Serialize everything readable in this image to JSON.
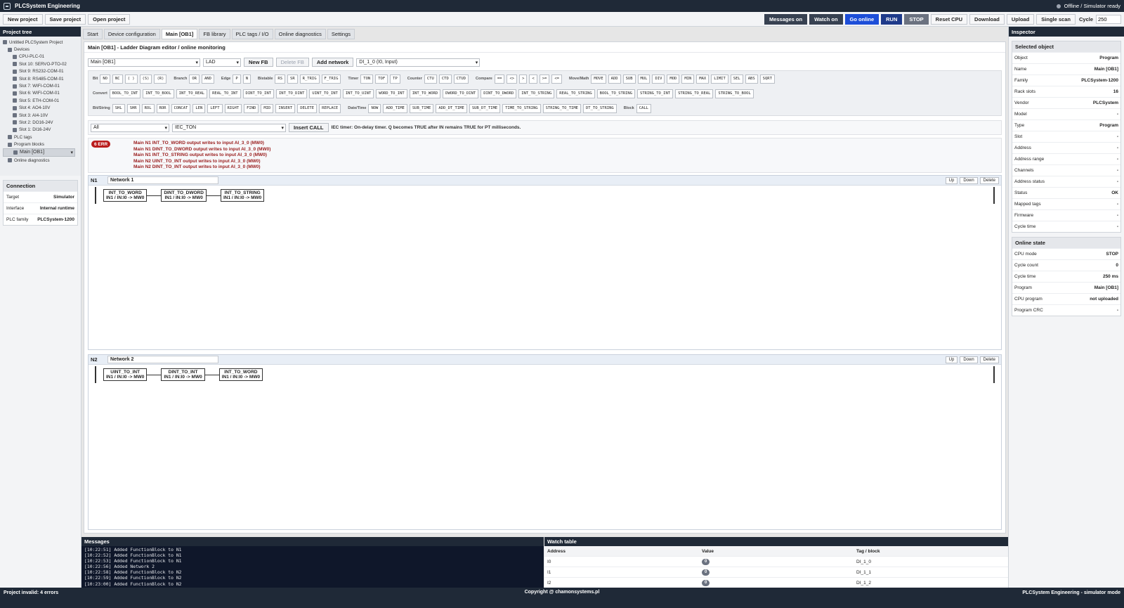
{
  "app": {
    "title": "PLCSystem Engineering",
    "status": "Offline / Simulator ready"
  },
  "toolbar": {
    "new_project": "New project",
    "save_project": "Save project",
    "open_project": "Open project",
    "messages_on": "Messages on",
    "watch_on": "Watch on",
    "go_online": "Go online",
    "run": "RUN",
    "stop": "STOP",
    "reset_cpu": "Reset CPU",
    "download": "Download",
    "upload": "Upload",
    "single_scan": "Single scan",
    "cycle_label": "Cycle",
    "cycle_value": "250"
  },
  "project_tree": {
    "title": "Project tree",
    "items": [
      "Untitled PLCSystem Project",
      "Devices",
      "CPU-PLC-01",
      "Slot 10: SERVO-PTO-02",
      "Slot 9: RS232-COM-01",
      "Slot 8: RS485-COM-01",
      "Slot 7: WIFI-COM-01",
      "Slot 6: WIFI-COM-01",
      "Slot 5: ETH-COM-01",
      "Slot 4: AO4-10V",
      "Slot 3: AI4-10V",
      "Slot 2: DO16-24V",
      "Slot 1: DI16-24V",
      "PLC tags",
      "Program blocks",
      "Main [OB1]",
      "Online diagnostics"
    ]
  },
  "connection": {
    "title": "Connection",
    "rows": [
      {
        "k": "Target",
        "v": "Simulator"
      },
      {
        "k": "Interface",
        "v": "Internal runtime"
      },
      {
        "k": "PLC family",
        "v": "PLCSystem-1200"
      }
    ]
  },
  "tabs": [
    "Start",
    "Device configuration",
    "Main [OB1]",
    "FB library",
    "PLC tags / I/O",
    "Online diagnostics",
    "Settings"
  ],
  "editor": {
    "title": "Main [OB1] - Ladder Diagram editor / online monitoring",
    "block_select": "Main [OB1]",
    "lang_select": "LAD",
    "new_fb": "New FB",
    "delete_fb": "Delete FB",
    "add_network": "Add network",
    "io_select": "DI_1_0 (I0, Input)"
  },
  "palette": {
    "row1": [
      {
        "g": "Bit",
        "b": [
          "NO",
          "NC",
          "( )",
          "(S)",
          "(R)"
        ]
      },
      {
        "g": "Branch",
        "b": [
          "OR",
          "AND"
        ]
      },
      {
        "g": "Edge",
        "b": [
          "P",
          "N"
        ]
      },
      {
        "g": "Bistable",
        "b": [
          "RS",
          "SR",
          "R_TRIG",
          "F_TRIG"
        ]
      },
      {
        "g": "Timer",
        "b": [
          "TON",
          "TOF",
          "TP"
        ]
      },
      {
        "g": "Counter",
        "b": [
          "CTU",
          "CTD",
          "CTUD"
        ]
      },
      {
        "g": "Compare",
        "b": [
          "==",
          "<>",
          ">",
          "<",
          ">=",
          "<="
        ]
      },
      {
        "g": "Move/Math",
        "b": [
          "MOVE",
          "ADD",
          "SUB",
          "MUL",
          "DIV",
          "MOD",
          "MIN",
          "MAX",
          "LIMIT",
          "SEL",
          "ABS",
          "SQRT"
        ]
      }
    ],
    "row2": [
      {
        "g": "Convert",
        "b": [
          "BOOL_TO_INT",
          "INT_TO_BOOL",
          "INT_TO_REAL",
          "REAL_TO_INT",
          "DINT_TO_INT",
          "INT_TO_DINT",
          "UINT_TO_INT",
          "INT_TO_UINT",
          "WORD_TO_INT",
          "INT_TO_WORD",
          "DWORD_TO_DINT",
          "DINT_TO_DWORD",
          "INT_TO_STRING",
          "REAL_TO_STRING",
          "BOOL_TO_STRING",
          "STRING_TO_INT",
          "STRING_TO_REAL",
          "STRING_TO_BOOL"
        ]
      }
    ],
    "row3": [
      {
        "g": "Bit/String",
        "b": [
          "SHL",
          "SHR",
          "ROL",
          "ROR",
          "CONCAT",
          "LEN",
          "LEFT",
          "RIGHT",
          "FIND",
          "MID",
          "INSERT",
          "DELETE",
          "REPLACE"
        ]
      },
      {
        "g": "Date/Time",
        "b": [
          "NOW",
          "ADD_TIME",
          "SUB_TIME",
          "ADD_DT_TIME",
          "SUB_DT_TIME",
          "TIME_TO_STRING",
          "STRING_TO_TIME",
          "DT_TO_STRING"
        ]
      },
      {
        "g": "Block",
        "b": [
          "CALL"
        ]
      }
    ]
  },
  "insert": {
    "filter": "All",
    "fb": "IEC_TON",
    "button": "Insert CALL",
    "hint": "IEC timer: On-delay timer. Q becomes TRUE after IN remains TRUE for PT milliseconds."
  },
  "errors": {
    "badge": "6 ERR",
    "lines": [
      "Main N1 INT_TO_WORD output writes to input AI_3_0 (MW0)",
      "Main N1 DINT_TO_DWORD output writes to input AI_3_0 (MW0)",
      "Main N1 INT_TO_STRING output writes to input AI_3_0 (MW0)",
      "Main N2 UINT_TO_INT output writes to input AI_3_0 (MW0)",
      "Main N2 DINT_TO_INT output writes to input AI_3_0 (MW0)"
    ]
  },
  "networks": [
    {
      "id": "N1",
      "name": "Network 1",
      "blocks": [
        {
          "t": "INT_TO_WORD",
          "p": "IN1 / IN:I0 -> MW0"
        },
        {
          "t": "DINT_TO_DWORD",
          "p": "IN1 / IN:I0 -> MW0"
        },
        {
          "t": "INT_TO_STRING",
          "p": "IN1 / IN:I0 -> MW0"
        }
      ]
    },
    {
      "id": "N2",
      "name": "Network 2",
      "blocks": [
        {
          "t": "UINT_TO_INT",
          "p": "IN1 / IN:I0 -> MW0"
        },
        {
          "t": "DINT_TO_INT",
          "p": "IN1 / IN:I0 -> MW0"
        },
        {
          "t": "INT_TO_WORD",
          "p": "IN1 / IN:I0 -> MW0"
        }
      ]
    }
  ],
  "net_actions": {
    "up": "Up",
    "down": "Down",
    "delete": "Delete"
  },
  "inspector": {
    "title": "Inspector",
    "selected_title": "Selected object",
    "selected": [
      {
        "k": "Object",
        "v": "Program"
      },
      {
        "k": "Name",
        "v": "Main [OB1]"
      },
      {
        "k": "Family",
        "v": "PLCSystem-1200"
      },
      {
        "k": "Rack slots",
        "v": "16"
      },
      {
        "k": "Vendor",
        "v": "PLCSystem"
      },
      {
        "k": "Model",
        "v": "-"
      },
      {
        "k": "Type",
        "v": "Program"
      },
      {
        "k": "Slot",
        "v": "-"
      },
      {
        "k": "Address",
        "v": "-"
      },
      {
        "k": "Address range",
        "v": "-"
      },
      {
        "k": "Channels",
        "v": "-"
      },
      {
        "k": "Address status",
        "v": "-"
      },
      {
        "k": "Status",
        "v": "OK"
      },
      {
        "k": "Mapped tags",
        "v": "-"
      },
      {
        "k": "Firmware",
        "v": "-"
      },
      {
        "k": "Cycle time",
        "v": "-"
      }
    ],
    "online_title": "Online state",
    "online": [
      {
        "k": "CPU mode",
        "v": "STOP"
      },
      {
        "k": "Cycle count",
        "v": "0"
      },
      {
        "k": "Cycle time",
        "v": "250 ms"
      },
      {
        "k": "Program",
        "v": "Main [OB1]"
      },
      {
        "k": "CPU program",
        "v": "not uploaded"
      },
      {
        "k": "Program CRC",
        "v": "-"
      }
    ]
  },
  "messages": {
    "title": "Messages",
    "lines": [
      "[10:22:51] Added FunctionBlock to N1",
      "[10:22:52] Added FunctionBlock to N1",
      "[10:22:53] Added FunctionBlock to N1",
      "[10:22:56] Added Network 2",
      "[10:22:58] Added FunctionBlock to N2",
      "[10:22:59] Added FunctionBlock to N2",
      "[10:23:00] Added FunctionBlock to N2"
    ]
  },
  "watch": {
    "title": "Watch table",
    "headers": [
      "Address",
      "Value",
      "Tag / block"
    ],
    "rows": [
      {
        "a": "I0",
        "v": "0",
        "t": "DI_1_0"
      },
      {
        "a": "I1",
        "v": "0",
        "t": "DI_1_1"
      },
      {
        "a": "I2",
        "v": "0",
        "t": "DI_1_2"
      }
    ]
  },
  "footer": {
    "left": "Project invalid: 4 errors",
    "center": "Copyright @ chamonsystems.pl",
    "right": "PLCSystem Engineering - simulator mode"
  }
}
